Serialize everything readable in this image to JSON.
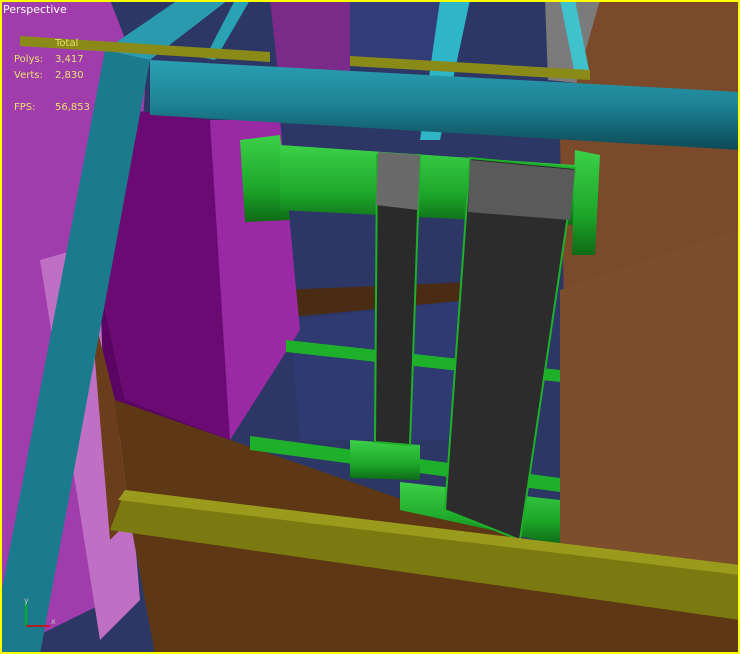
{
  "viewport": {
    "label": "Perspective",
    "border_color": "#ffff00"
  },
  "stats": {
    "header": "Total",
    "polys_label": "Polys:",
    "polys_value": "3,417",
    "verts_label": "Verts:",
    "verts_value": "2,830",
    "fps_label": "FPS:",
    "fps_value": "56,853"
  },
  "axis_gizmo": {
    "y_label": "y",
    "x_label": "x",
    "y_color": "#00c000",
    "x_color": "#e00000"
  },
  "colors": {
    "background": "#2c3766",
    "cyan_frame": "#1e8294",
    "magenta_panel": "#8a1c96",
    "brown_panel": "#6e4422",
    "olive_beam": "#7a7a10",
    "green_parts": "#1ea82a",
    "dark_arm": "#2e2e2e"
  }
}
